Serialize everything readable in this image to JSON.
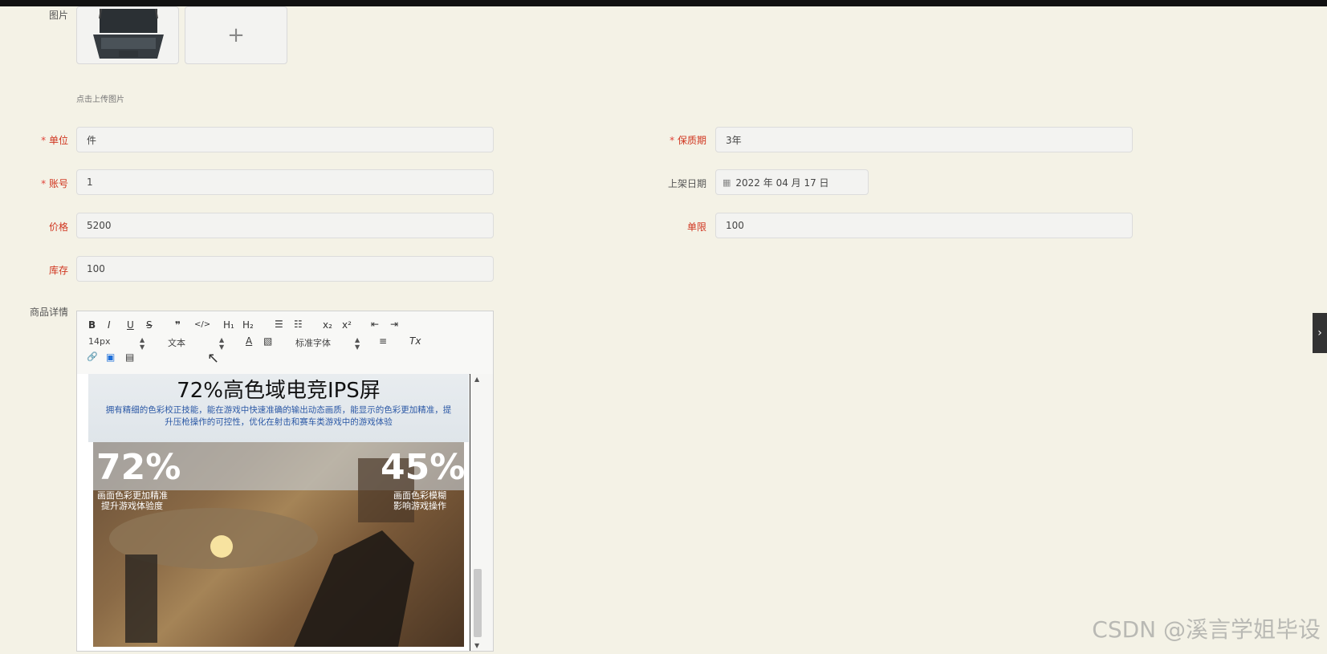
{
  "image_section": {
    "label": "图片",
    "add_symbol": "+",
    "hint": "点击上传图片"
  },
  "fields": {
    "unit": {
      "label": "单位",
      "value": "件"
    },
    "shelf_life": {
      "label": "保质期",
      "value": "3年"
    },
    "account": {
      "label": "账号",
      "value": "1"
    },
    "listing_date": {
      "label": "上架日期",
      "value": "2022 年 04 月 17 日"
    },
    "price": {
      "label": "价格",
      "value": "5200"
    },
    "limit": {
      "label": "单限",
      "value": "100"
    },
    "stock": {
      "label": "库存",
      "value": "100"
    },
    "details": {
      "label": "商品详情"
    }
  },
  "editor": {
    "toolbar": {
      "bold": "B",
      "italic": "I",
      "underline": "U",
      "strike": "S",
      "quote": "❞",
      "code": "</>",
      "h1": "H₁",
      "h2": "H₂",
      "ordered_list": "☰",
      "bullet_list": "☷",
      "sub": "x₂",
      "sup": "x²",
      "outdent": "⇤",
      "indent": "⇥",
      "font_size": "14px",
      "block_type": "文本",
      "font_family": "标准字体",
      "color": "A",
      "bg": "▧",
      "align": "≡",
      "clear": "Tx",
      "link": "🔗",
      "image": "▣",
      "video": "▤"
    },
    "content": {
      "title": "72%高色域电竞IPS屏",
      "desc": "拥有精细的色彩校正技能，能在游戏中快速准确的输出动态画质，能显示的色彩更加精准，提升压枪操作的可控性，优化在射击和赛车类游戏中的游戏体验",
      "left_big": "72%",
      "left_small_1": "画面色彩更加精准",
      "left_small_2": "提升游戏体验度",
      "right_big": "45%",
      "right_small_1": "画面色彩模糊",
      "right_small_2": "影响游戏操作"
    }
  },
  "watermark": "CSDN @溪言学姐毕设",
  "right_tab_icon": "›"
}
